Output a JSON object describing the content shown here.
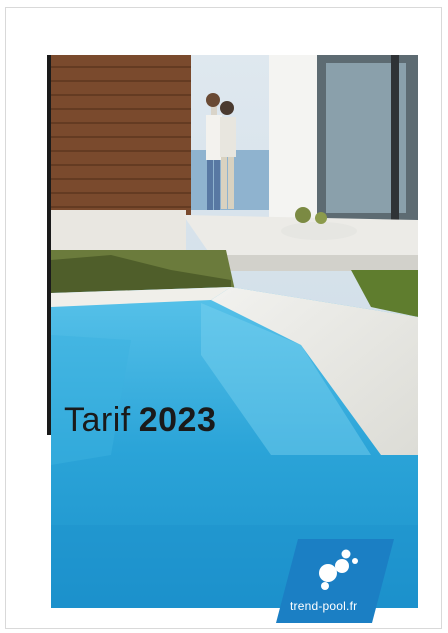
{
  "document": {
    "title_word": "Tarif",
    "title_year": "2023",
    "brand": "trend-pool.fr"
  },
  "colors": {
    "pool_water": "#2aa3d6",
    "brand_blue": "#1b7fc4",
    "title_text": "#1a1a1a"
  },
  "icons": {
    "logo": "bubbles-logo-icon"
  }
}
